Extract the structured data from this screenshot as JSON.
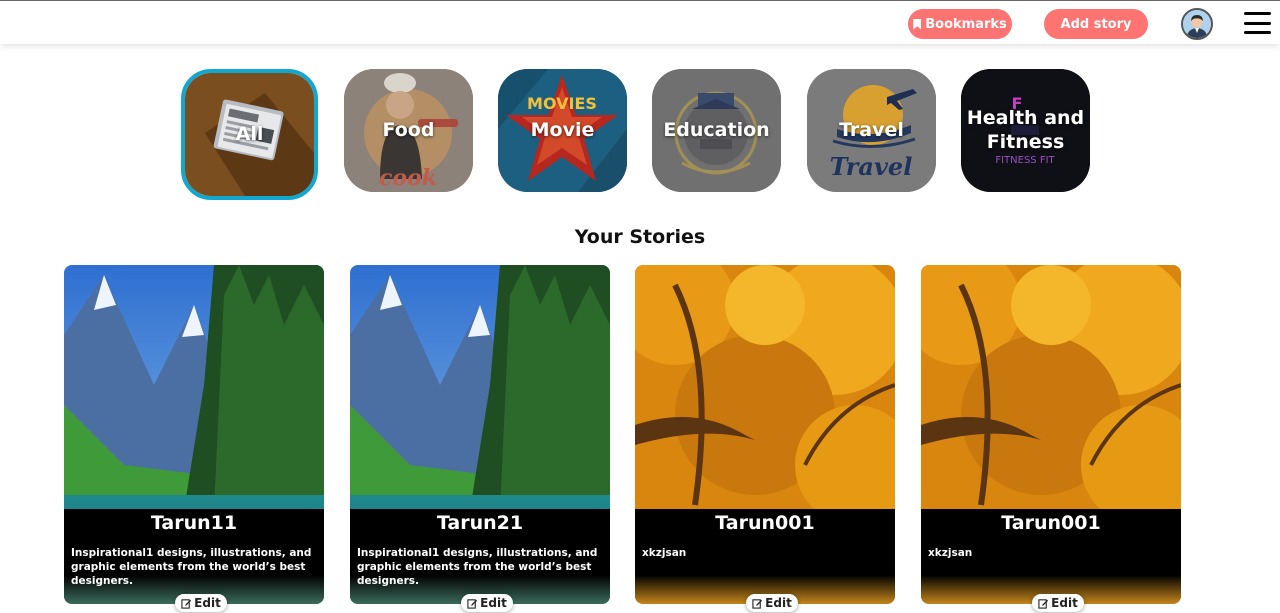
{
  "header": {
    "bookmarks_label": "Bookmarks",
    "add_story_label": "Add story",
    "bookmark_icon": "bookmark-icon",
    "menu_icon": "hamburger-menu-icon",
    "accent": "#ff7373"
  },
  "categories": [
    {
      "label": "All",
      "active": true,
      "icon": "newspaper-icon"
    },
    {
      "label": "Food",
      "active": false,
      "icon": "chef-cook-image"
    },
    {
      "label": "Movie",
      "active": false,
      "icon": "movies-star-image"
    },
    {
      "label": "Education",
      "active": false,
      "icon": "university-crest-image"
    },
    {
      "label": "Travel",
      "active": false,
      "icon": "travel-plane-image"
    },
    {
      "label": "Health and Fitness",
      "active": false,
      "icon": "fitness-image"
    }
  ],
  "section_title": "Your Stories",
  "stories": [
    {
      "title": "Tarun11",
      "description": "Inspirational1 designs, illustrations, and graphic elements from the world’s best designers.",
      "image": "mountain-lake-image",
      "edit_label": "Edit"
    },
    {
      "title": "Tarun21",
      "description": "Inspirational1 designs, illustrations, and graphic elements from the world’s best designers.",
      "image": "mountain-lake-image",
      "edit_label": "Edit"
    },
    {
      "title": "Tarun001",
      "description": "xkzjsan",
      "image": "autumn-tree-image",
      "edit_label": "Edit"
    },
    {
      "title": "Tarun001",
      "description": "xkzjsan",
      "image": "autumn-tree-image",
      "edit_label": "Edit"
    }
  ]
}
